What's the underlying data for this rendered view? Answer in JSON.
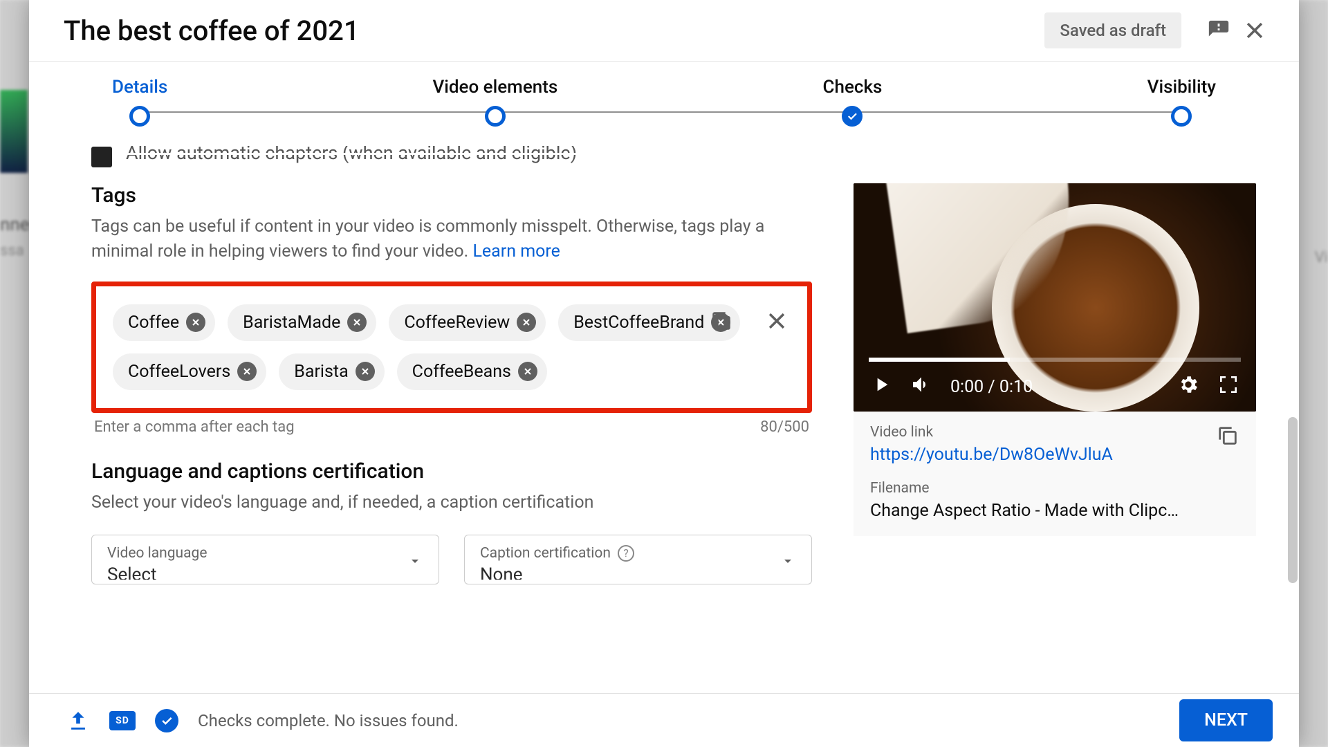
{
  "header": {
    "title": "The best coffee of 2021",
    "saved_label": "Saved as draft"
  },
  "stepper": {
    "details": "Details",
    "elements": "Video elements",
    "checks": "Checks",
    "visibility": "Visibility"
  },
  "chapters": {
    "label": "Allow automatic chapters (when available and eligible)"
  },
  "tags": {
    "heading": "Tags",
    "description": "Tags can be useful if content in your video is commonly misspelt. Otherwise, tags play a minimal role in helping viewers to find your video. ",
    "learn_more": "Learn more",
    "items": [
      "Coffee",
      "BaristaMade",
      "CoffeeReview",
      "BestCoffeeBrand",
      "CoffeeLovers",
      "Barista",
      "CoffeeBeans"
    ],
    "helper": "Enter a comma after each tag",
    "counter": "80/500"
  },
  "language": {
    "heading": "Language and captions certification",
    "description": "Select your video's language and, if needed, a caption certification",
    "video_language_label": "Video language",
    "video_language_value": "Select",
    "caption_label": "Caption certification",
    "caption_value": "None"
  },
  "preview": {
    "time": "0:00 / 0:10",
    "link_label": "Video link",
    "link": "https://youtu.be/Dw8OeWvJluA",
    "filename_label": "Filename",
    "filename": "Change Aspect Ratio - Made with Clipc…"
  },
  "footer": {
    "status": "Checks complete. No issues found.",
    "next": "NEXT"
  },
  "bg": {
    "t1": "nne",
    "t2": "ssa",
    "t3": "Vi"
  }
}
